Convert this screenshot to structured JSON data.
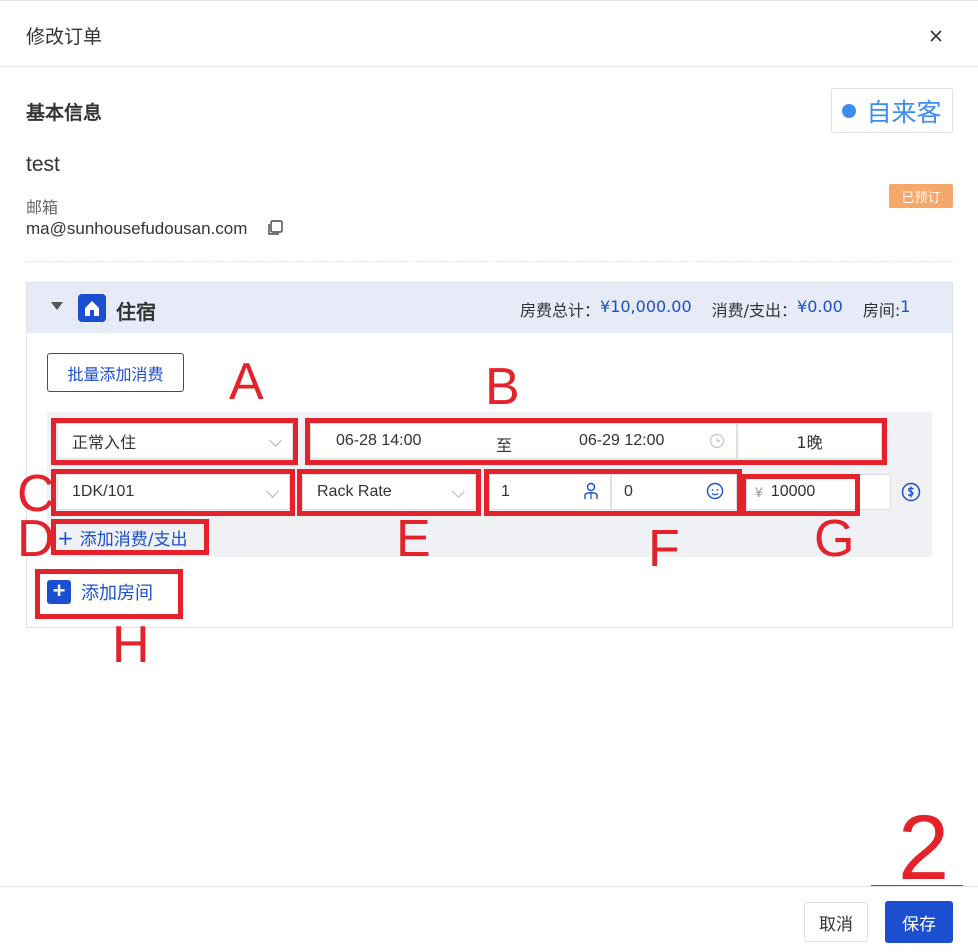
{
  "modal": {
    "title": "修改订单",
    "close_icon": "close-icon"
  },
  "basic_info": {
    "section_title": "基本信息",
    "source_badge": "自来客",
    "guest_name": "test",
    "email_label": "邮箱",
    "email": "ma@sunhousefudousan.com",
    "status": "已预订"
  },
  "stay": {
    "title": "住宿",
    "room_fee_label": "房费总计：",
    "room_fee_value": "¥10,000.00",
    "expense_label": "消费/支出：",
    "expense_value": "¥0.00",
    "rooms_label": "房间:",
    "rooms_value": "1",
    "bulk_add_label": "批量添加消费",
    "stay_type": "正常入住",
    "date_start": "06-28 14:00",
    "date_separator": "至",
    "date_end": "06-29 12:00",
    "nights": "1晚",
    "room": "1DK/101",
    "rate_plan": "Rack Rate",
    "adults": "1",
    "children": "0",
    "currency_symbol": "¥",
    "price": "10000",
    "add_expense_label": "添加消费/支出",
    "add_room_label": "添加房间"
  },
  "annotations": {
    "A": "A",
    "B": "B",
    "C": "C",
    "D": "D",
    "E": "E",
    "F": "F",
    "G": "G",
    "H": "H",
    "step": "2"
  },
  "footer": {
    "cancel_label": "取消",
    "save_label": "保存"
  },
  "colors": {
    "primary": "#1b4fd0",
    "source_blue": "#3c8cf0",
    "status_orange": "#f6a76a",
    "annotation_red": "#e4222b"
  }
}
